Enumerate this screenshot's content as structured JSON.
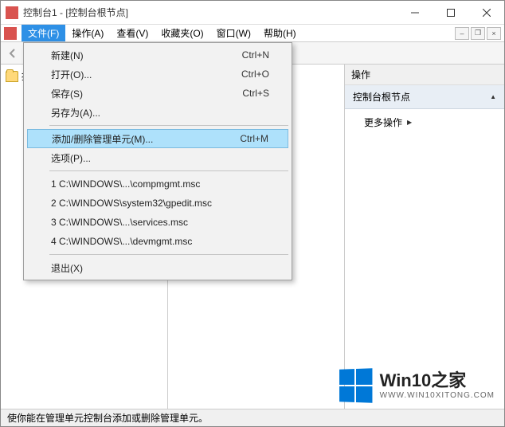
{
  "window": {
    "title": "控制台1 - [控制台根节点]"
  },
  "menubar": {
    "items": [
      {
        "label": "文件(F)",
        "active": true
      },
      {
        "label": "操作(A)"
      },
      {
        "label": "查看(V)"
      },
      {
        "label": "收藏夹(O)"
      },
      {
        "label": "窗口(W)"
      },
      {
        "label": "帮助(H)"
      }
    ]
  },
  "dropdown": {
    "groups": [
      [
        {
          "label": "新建(N)",
          "shortcut": "Ctrl+N"
        },
        {
          "label": "打开(O)...",
          "shortcut": "Ctrl+O"
        },
        {
          "label": "保存(S)",
          "shortcut": "Ctrl+S"
        },
        {
          "label": "另存为(A)...",
          "shortcut": ""
        }
      ],
      [
        {
          "label": "添加/删除管理单元(M)...",
          "shortcut": "Ctrl+M",
          "highlight": true
        },
        {
          "label": "选项(P)...",
          "shortcut": ""
        }
      ],
      [
        {
          "label": "1 C:\\WINDOWS\\...\\compmgmt.msc",
          "shortcut": ""
        },
        {
          "label": "2 C:\\WINDOWS\\system32\\gpedit.msc",
          "shortcut": ""
        },
        {
          "label": "3 C:\\WINDOWS\\...\\services.msc",
          "shortcut": ""
        },
        {
          "label": "4 C:\\WINDOWS\\...\\devmgmt.msc",
          "shortcut": ""
        }
      ],
      [
        {
          "label": "退出(X)",
          "shortcut": ""
        }
      ]
    ]
  },
  "tree": {
    "root_label": "控制台根节点"
  },
  "actions": {
    "header": "操作",
    "section": "控制台根节点",
    "more": "更多操作"
  },
  "statusbar": {
    "text": "使你能在管理单元控制台添加或删除管理单元。"
  },
  "watermark": {
    "big": "Win10之家",
    "small": "WWW.WIN10XITONG.COM"
  }
}
